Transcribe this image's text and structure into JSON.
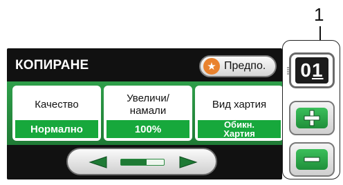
{
  "callout": {
    "number": "1"
  },
  "screen": {
    "title": "КОПИРАНЕ",
    "pref_button": {
      "label": "Предпо.",
      "icon": "star-icon"
    },
    "cards": [
      {
        "label": "Качество",
        "value": "Нормално"
      },
      {
        "label": "Увеличи/\nнамали",
        "value": "100%"
      },
      {
        "label": "Вид хартия",
        "value": "Обикн.\nХартия"
      }
    ],
    "nav": {
      "left_icon": "left-arrow-icon",
      "right_icon": "right-arrow-icon",
      "slider_fraction": 0.6
    }
  },
  "counter": {
    "value_prefix": "0",
    "value_cursor": "1"
  },
  "buttons": {
    "plus_icon": "plus-icon",
    "minus_icon": "minus-icon"
  },
  "colors": {
    "accent_green": "#1fa83c",
    "orange_star": "#e9822e",
    "screen_bg": "#111111"
  }
}
